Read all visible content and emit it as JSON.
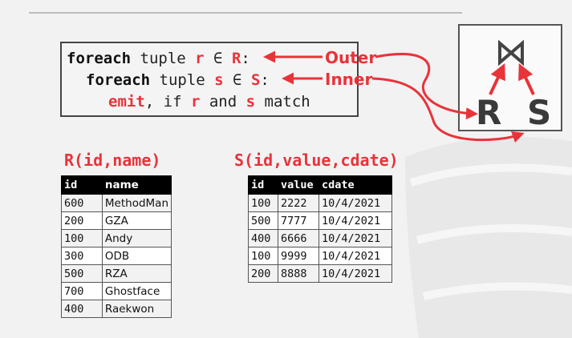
{
  "code": {
    "line1": {
      "kw": "foreach",
      "t1": " tuple ",
      "var": "r",
      "t2": " ∈ ",
      "rel": "R",
      "t3": ":"
    },
    "line2": {
      "kw": "foreach",
      "t1": " tuple ",
      "var": "s",
      "t2": " ∈ ",
      "rel": "S",
      "t3": ":"
    },
    "line3": {
      "kw": "emit",
      "t1": ", if ",
      "var1": "r",
      "t2": " and ",
      "var2": "s",
      "t3": " match"
    }
  },
  "annotations": {
    "outer": "Outer",
    "inner": "Inner"
  },
  "plan": {
    "join_symbol": "⋈",
    "left": "R",
    "right": "S"
  },
  "r_table": {
    "title": "R(id,name)",
    "columns": [
      "id",
      "name"
    ],
    "rows": [
      [
        "600",
        "MethodMan"
      ],
      [
        "200",
        "GZA"
      ],
      [
        "100",
        "Andy"
      ],
      [
        "300",
        "ODB"
      ],
      [
        "500",
        "RZA"
      ],
      [
        "700",
        "Ghostface"
      ],
      [
        "400",
        "Raekwon"
      ]
    ]
  },
  "s_table": {
    "title": "S(id,value,cdate)",
    "columns": [
      "id",
      "value",
      "cdate"
    ],
    "rows": [
      [
        "100",
        "2222",
        "10/4/2021"
      ],
      [
        "500",
        "7777",
        "10/4/2021"
      ],
      [
        "400",
        "6666",
        "10/4/2021"
      ],
      [
        "100",
        "9999",
        "10/4/2021"
      ],
      [
        "200",
        "8888",
        "10/4/2021"
      ]
    ]
  },
  "colors": {
    "accent": "#e8333a",
    "header": "#000000",
    "border": "#444444"
  }
}
